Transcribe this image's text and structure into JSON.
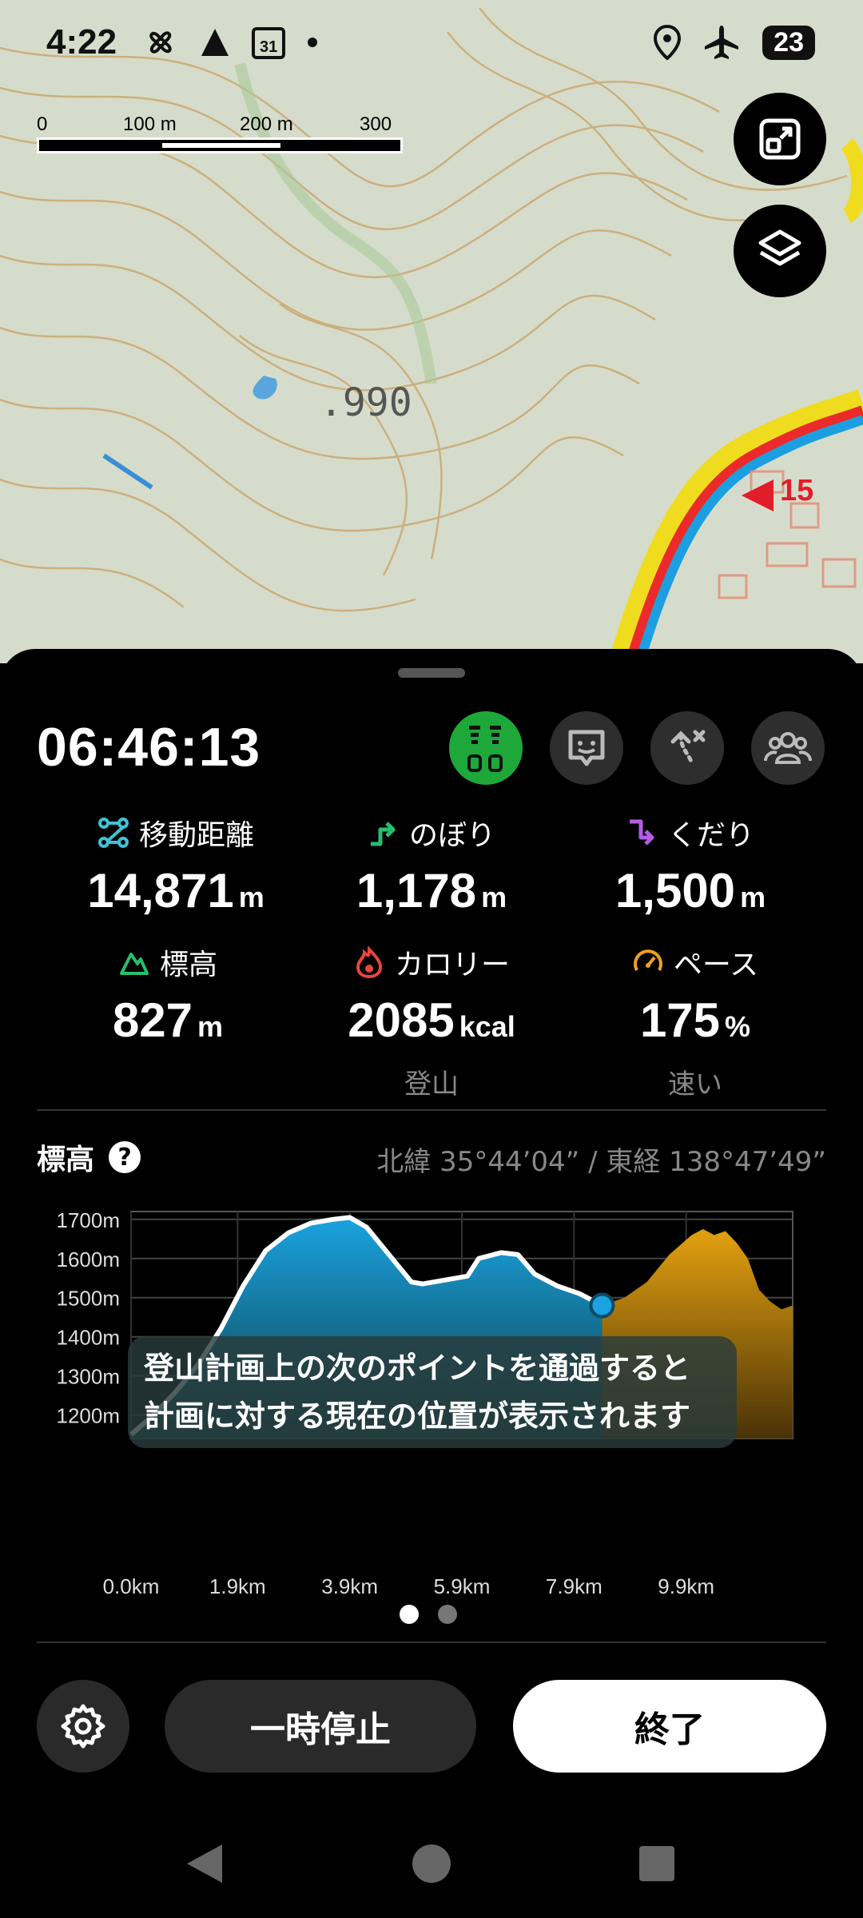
{
  "status_bar": {
    "time": "4:22",
    "battery": "23",
    "icons": [
      "fan-icon",
      "signal-icon",
      "calendar-icon",
      "dot-icon",
      "location-icon",
      "airplane-icon"
    ]
  },
  "map": {
    "scale_labels": [
      "0",
      "100 m",
      "200 m",
      "300 m"
    ],
    "elevation_label": ".990",
    "road_number": "15",
    "buttons": [
      "fit-route-icon",
      "layers-icon"
    ]
  },
  "sheet": {
    "elapsed_time": "06:46:13",
    "action_buttons": [
      "route-markers-icon",
      "face-icon",
      "route-branch-icon",
      "group-icon"
    ],
    "stats": [
      {
        "label": "移動距離",
        "value": "14,871",
        "unit": "m",
        "icon": "distance-icon",
        "color": "#3fc3d6",
        "sub": ""
      },
      {
        "label": "のぼり",
        "value": "1,178",
        "unit": "m",
        "icon": "ascent-icon",
        "color": "#26c06e",
        "sub": ""
      },
      {
        "label": "くだり",
        "value": "1,500",
        "unit": "m",
        "icon": "descent-icon",
        "color": "#b35ce6",
        "sub": ""
      },
      {
        "label": "標高",
        "value": "827",
        "unit": "m",
        "icon": "mountain-icon",
        "color": "#26c06e",
        "sub": ""
      },
      {
        "label": "カロリー",
        "value": "2085",
        "unit": "kcal",
        "icon": "flame-icon",
        "color": "#e8453c",
        "sub": "登山"
      },
      {
        "label": "ペース",
        "value": "175",
        "unit": "%",
        "icon": "speedometer-icon",
        "color": "#f0a020",
        "sub": "速い"
      }
    ],
    "elevation_title": "標高",
    "coordinates": "北緯 35°44’04” / 東経 138°47’49”",
    "tooltip_line1": "登山計画上の次のポイントを通過すると",
    "tooltip_line2": "計画に対する現在の位置が表示されます",
    "pause_label": "一時停止",
    "finish_label": "終了"
  },
  "colors": {
    "accent_green": "#1fa83a",
    "traveled_fill": "#1aa3e0",
    "planned_fill": "#e3a10f"
  },
  "chart_data": {
    "type": "area",
    "ylabel": "",
    "xlabel": "",
    "y_ticks": [
      "1700m",
      "1600m",
      "1500m",
      "1400m",
      "1300m",
      "1200m"
    ],
    "x_ticks": [
      "0.0km",
      "1.9km",
      "3.9km",
      "5.9km",
      "7.9km",
      "9.9km"
    ],
    "ylim": [
      1140,
      1720
    ],
    "xlim": [
      0,
      11.8
    ],
    "current_position_km": 8.4,
    "series": [
      {
        "x": [
          0.0,
          0.4,
          0.8,
          1.2,
          1.6,
          2.0,
          2.4,
          2.8,
          3.2,
          3.6,
          3.9,
          4.2,
          4.6,
          5.0,
          5.2,
          5.6,
          6.0,
          6.2,
          6.6,
          6.9,
          7.2,
          7.6,
          8.0,
          8.4
        ],
        "values": [
          1150,
          1200,
          1260,
          1330,
          1420,
          1530,
          1620,
          1665,
          1690,
          1700,
          1705,
          1680,
          1610,
          1540,
          1535,
          1545,
          1555,
          1600,
          1615,
          1610,
          1560,
          1530,
          1510,
          1480
        ]
      },
      {
        "x": [
          8.4,
          8.8,
          9.2,
          9.6,
          10.0,
          10.2,
          10.4,
          10.6,
          10.8,
          11.0,
          11.2,
          11.4,
          11.6,
          11.8
        ],
        "values": [
          1480,
          1500,
          1540,
          1610,
          1660,
          1675,
          1660,
          1670,
          1640,
          1600,
          1520,
          1490,
          1470,
          1480
        ]
      }
    ]
  }
}
